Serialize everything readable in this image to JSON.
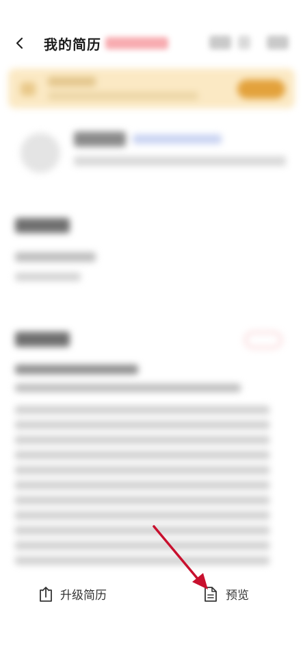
{
  "header": {
    "title": "我的简历",
    "back_icon": "chevron-left-icon"
  },
  "bottom_bar": {
    "upgrade_label": "升级简历",
    "upgrade_icon": "upload-icon",
    "preview_label": "预览",
    "preview_icon": "document-icon"
  },
  "colors": {
    "banner_bg": "#fbe9c4",
    "accent_red": "#c8102e",
    "text_dark": "#1d1d1d"
  }
}
